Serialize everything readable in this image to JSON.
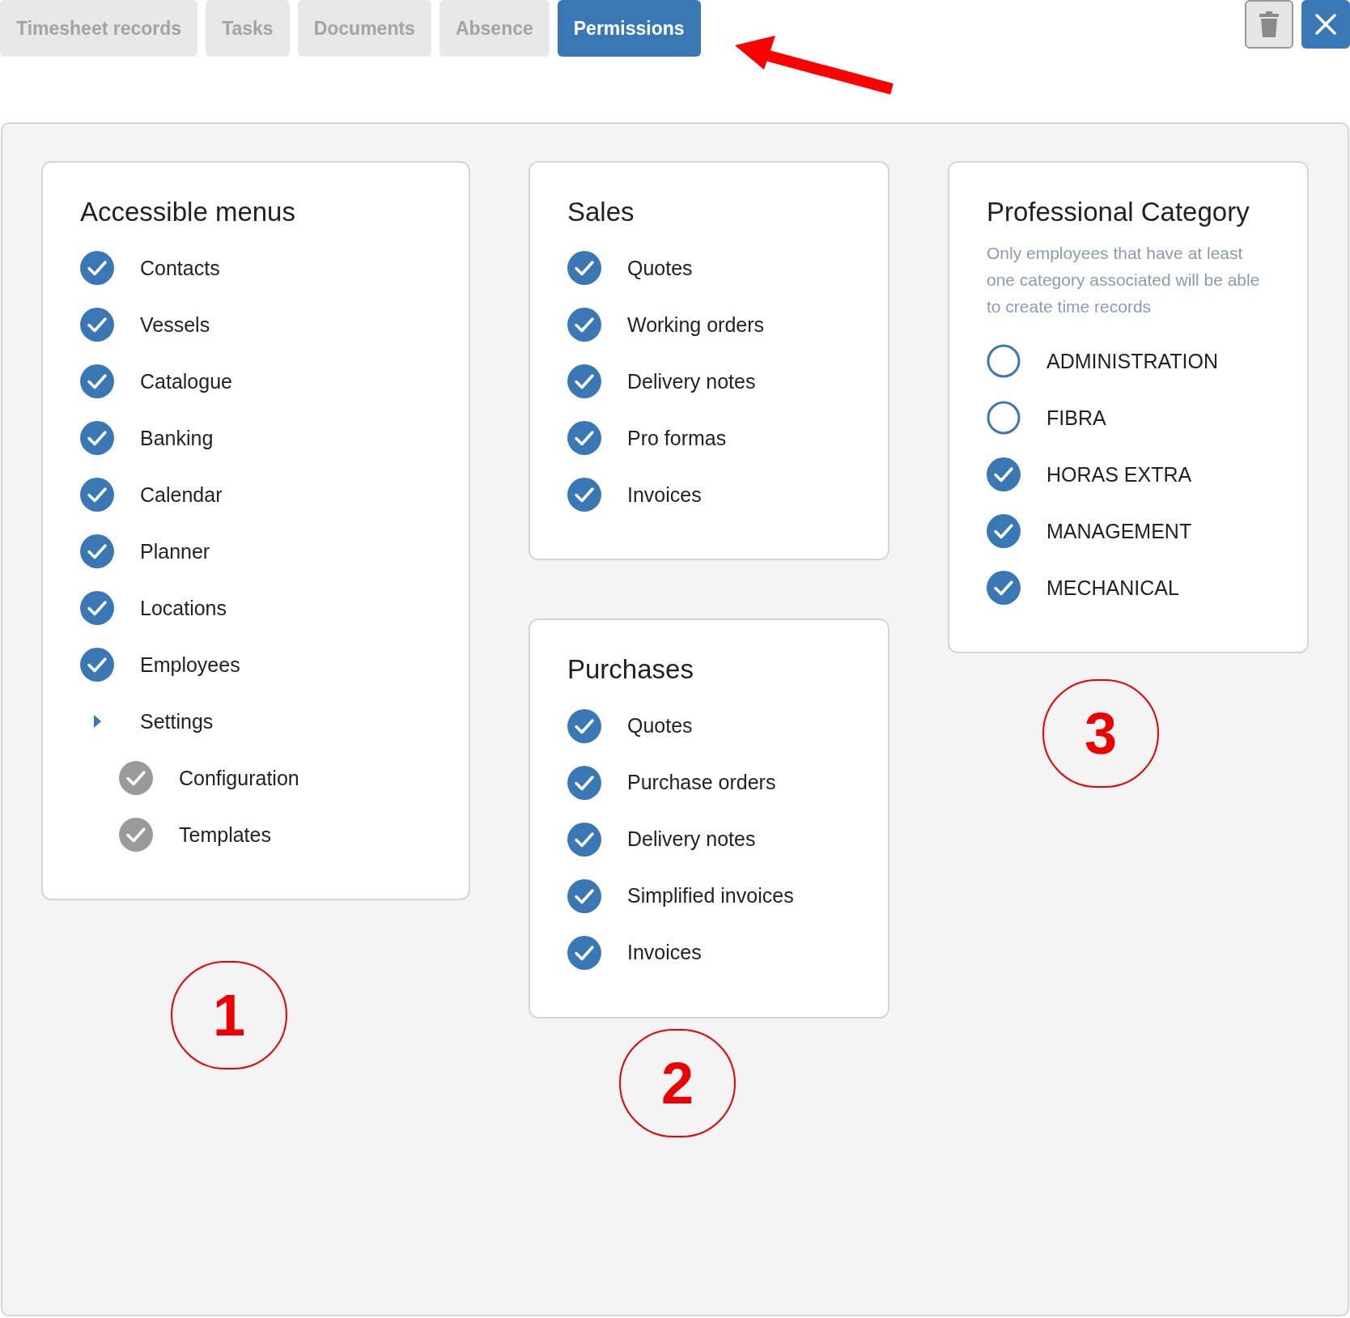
{
  "tabs": [
    {
      "label": "Timesheet records",
      "selected": false
    },
    {
      "label": "Tasks",
      "selected": false
    },
    {
      "label": "Documents",
      "selected": false
    },
    {
      "label": "Absence",
      "selected": false
    },
    {
      "label": "Permissions",
      "selected": true
    }
  ],
  "columns": [
    {
      "cards": [
        {
          "title": "Accessible menus",
          "items": [
            {
              "kind": "check",
              "label": "Contacts",
              "checked": true,
              "disabled": false
            },
            {
              "kind": "check",
              "label": "Vessels",
              "checked": true,
              "disabled": false
            },
            {
              "kind": "check",
              "label": "Catalogue",
              "checked": true,
              "disabled": false
            },
            {
              "kind": "check",
              "label": "Banking",
              "checked": true,
              "disabled": false
            },
            {
              "kind": "check",
              "label": "Calendar",
              "checked": true,
              "disabled": false
            },
            {
              "kind": "check",
              "label": "Planner",
              "checked": true,
              "disabled": false
            },
            {
              "kind": "check",
              "label": "Locations",
              "checked": true,
              "disabled": false
            },
            {
              "kind": "check",
              "label": "Employees",
              "checked": true,
              "disabled": false
            },
            {
              "kind": "group",
              "label": "Settings",
              "expanded": true,
              "children": [
                {
                  "kind": "check",
                  "label": "Configuration",
                  "checked": true,
                  "disabled": true
                },
                {
                  "kind": "check",
                  "label": "Templates",
                  "checked": true,
                  "disabled": true
                }
              ]
            }
          ]
        }
      ],
      "marker": "1"
    },
    {
      "cards": [
        {
          "title": "Sales",
          "items": [
            {
              "kind": "check",
              "label": "Quotes",
              "checked": true,
              "disabled": false
            },
            {
              "kind": "check",
              "label": "Working orders",
              "checked": true,
              "disabled": false
            },
            {
              "kind": "check",
              "label": "Delivery notes",
              "checked": true,
              "disabled": false
            },
            {
              "kind": "check",
              "label": "Pro formas",
              "checked": true,
              "disabled": false
            },
            {
              "kind": "check",
              "label": "Invoices",
              "checked": true,
              "disabled": false
            }
          ]
        },
        {
          "title": "Purchases",
          "items": [
            {
              "kind": "check",
              "label": "Quotes",
              "checked": true,
              "disabled": false
            },
            {
              "kind": "check",
              "label": "Purchase orders",
              "checked": true,
              "disabled": false
            },
            {
              "kind": "check",
              "label": "Delivery notes",
              "checked": true,
              "disabled": false
            },
            {
              "kind": "check",
              "label": "Simplified invoices",
              "checked": true,
              "disabled": false
            },
            {
              "kind": "check",
              "label": "Invoices",
              "checked": true,
              "disabled": false
            }
          ]
        }
      ],
      "marker": "2"
    },
    {
      "cards": [
        {
          "title": "Professional Category",
          "description": "Only employees that have at least one category associated will be able to create time records",
          "items": [
            {
              "kind": "check",
              "label": "ADMINISTRATION",
              "checked": false,
              "disabled": false
            },
            {
              "kind": "check",
              "label": "FIBRA",
              "checked": false,
              "disabled": false
            },
            {
              "kind": "check",
              "label": "HORAS EXTRA",
              "checked": true,
              "disabled": false
            },
            {
              "kind": "check",
              "label": "MANAGEMENT",
              "checked": true,
              "disabled": false
            },
            {
              "kind": "check",
              "label": "MECHANICAL",
              "checked": true,
              "disabled": false
            }
          ]
        }
      ],
      "marker": "3"
    }
  ]
}
